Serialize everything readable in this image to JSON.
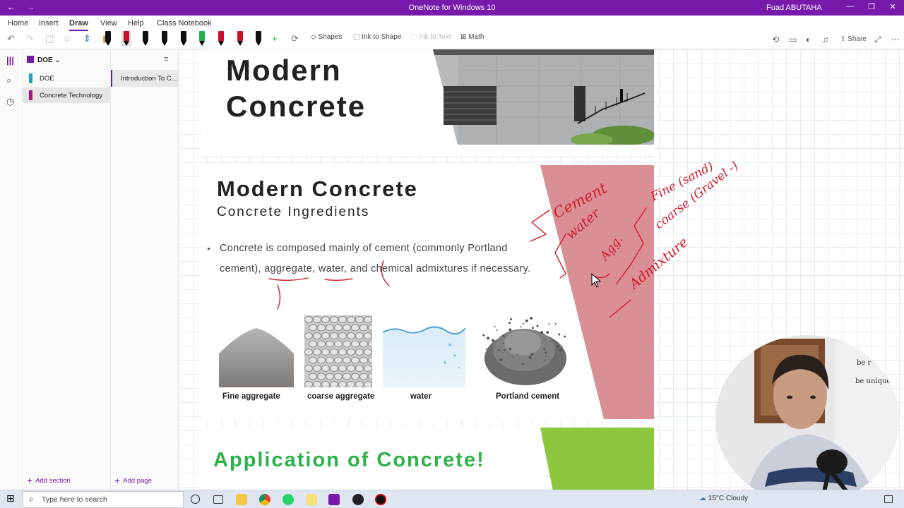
{
  "window": {
    "title": "OneNote for Windows 10",
    "user": "Fuad ABUTAHA",
    "back_glyph": "←",
    "fwd_glyph": "→",
    "min_glyph": "—",
    "restore_glyph": "❐",
    "close_glyph": "✕"
  },
  "ribbon": {
    "tabs": [
      "Home",
      "Insert",
      "Draw",
      "View",
      "Help",
      "Class Notebook"
    ],
    "active_tab": "Draw",
    "tools": {
      "shapes": "Shapes",
      "ink_to_shape": "Ink to Shape",
      "ink_to_text": "Ink to Text",
      "math": "Math"
    },
    "share": "Share",
    "pens": [
      {
        "color": "#111111"
      },
      {
        "color": "#c8102e"
      },
      {
        "color": "#111111"
      },
      {
        "color": "#111111"
      },
      {
        "color": "#111111"
      },
      {
        "color": "#22b14c"
      },
      {
        "color": "#c8102e"
      },
      {
        "color": "#c8102e"
      },
      {
        "color": "#111111"
      }
    ]
  },
  "notebook": {
    "name": "DOE",
    "sections": [
      {
        "label": "DOE",
        "color": "#1aa5c4"
      },
      {
        "label": "Concrete Technology",
        "color": "#b0127e"
      }
    ],
    "active_section": "Concrete Technology",
    "add_section": "Add section"
  },
  "pages": {
    "items": [
      "Introduction To C..."
    ],
    "add_page": "Add page"
  },
  "slide1": {
    "title_line1": "Modern",
    "title_line2": "Concrete"
  },
  "slide2": {
    "title": "Modern Concrete",
    "subtitle": "Concrete Ingredients",
    "bullet_marker": "▸",
    "bullet_parts": {
      "p1": "Concrete is composed mainly of cement (commonly Portland cement), ",
      "aggregate": "aggregate",
      "sep1": ", ",
      "water": "water",
      "p2": ", and chemical admixtures if necessary."
    },
    "ingredients": [
      {
        "label": "Fine aggregate"
      },
      {
        "label": "coarse aggregate"
      },
      {
        "label": "water"
      },
      {
        "label": "Portland cement"
      }
    ],
    "band_color": "#d98f94"
  },
  "slide3": {
    "title": "Application of Concrete!",
    "title_color": "#2bb34a",
    "band_color": "#8dc63f"
  },
  "ink": {
    "color": "#d21b2b",
    "cement": "Cement",
    "water": "water",
    "agg": "Agg.",
    "fine": "Fine (sand)",
    "coarse": "coarse (Gravel -)",
    "admix": "Admixture"
  },
  "webcam": {
    "text1": "be r",
    "text2": "be unique"
  },
  "taskbar": {
    "search_placeholder": "Type here to search",
    "weather": "15°C  Cloudy",
    "start_glyph": "⊞",
    "search_glyph": "⌕"
  }
}
